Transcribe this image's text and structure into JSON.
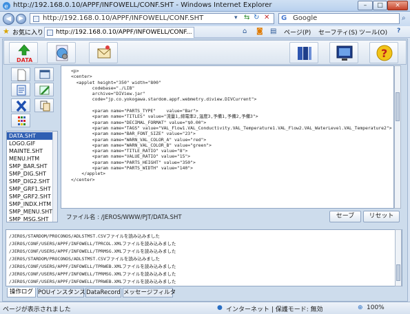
{
  "window": {
    "title": "http://192.168.0.10/APPF/INFOWELL/CONF.SHT - Windows Internet Explorer",
    "controls": {
      "minimize": "–",
      "maximize": "□",
      "close": "×"
    }
  },
  "browser": {
    "address": "http://192.168.0.10/APPF/INFOWELL/CONF.SHT",
    "search_placeholder": "Google",
    "favorites_label": "お気に入り",
    "tab_title": "http://192.168.0.10/APPF/INFOWELL/CONF...",
    "commands": {
      "page": "ページ(P)",
      "safety": "セーフティ(S)",
      "tools": "ツール(O)",
      "help": "?"
    }
  },
  "toolbar": {
    "data_label": "DATA"
  },
  "file_list": {
    "items": [
      "DATA.SHT",
      "LOGO.GIF",
      "MAINTE.SHT",
      "MENU.HTM",
      "SMP_BAR.SHT",
      "SMP_DIG.SHT",
      "SMP_DIG2.SHT",
      "SMP_GRF1.SHT",
      "SMP_GRF2.SHT",
      "SMP_INDX.HTM",
      "SMP_MENU.SHT",
      "SMP_MSG.SHT"
    ],
    "selected_index": 0
  },
  "editor": {
    "code": "<p>\n<center>\n  <applet height=\"350\" width=\"800\"\n        codebase=\"./LIB\"\n        archive=\"DIView.jar\"\n        code=\"jp.co.yokogawa.stardom.appf.webmetry.diview.DIVCurrent\">\n\n        <param name=\"PARTS_TYPE\"    value=\"Bar\">\n        <param name=\"TITLES\" value=\"流量1,締電率2,温度3,予備1,予備2,予備3\">\n        <param name=\"DECIMAL_FORMAT\" value=\"$0.00\">\n        <param name=\"TAGS\" value=\"VAL_Flow1.VAL_Conductivity.VAL_Temperature1.VAL_Flow2.VAL_WaterLevel.VAL_Temperature2\">\n        <param name=\"BAR_FONT_SIZE\" value=\"23\">\n        <param name=\"WARN_VAL_COLOR_A\" value=\"red\">\n        <param name=\"WARN_VAL_COLOR_B\" value=\"green\">\n        <param name=\"TITLE_RATIO\" value=\"8\">\n        <param name=\"VALUE_RATIO\" value=\"15\">\n        <param name=\"PARTS_HEIGHT\" value=\"350\">\n        <param name=\"PARTS_WIDTH\" value=\"140\">\n    </applet>\n</center>",
    "file_name_label": "ファイル名 : /JEROS/WWW/PJT/DATA.SHT",
    "save_label": "セーブ",
    "reset_label": "リセット"
  },
  "log": {
    "lines": [
      "/JEROS/STARDOM/PROCONOS/ADLSTMST.CSVファイルを読み込みました",
      "/JEROS/CONF/USERS/APPF/INFOWELL/TPRCOL.XMLファイルを読み込みました",
      "/JEROS/CONF/USERS/APPF/INFOWELL/TPRMSG.XMLファイルを読み込みました",
      "/JEROS/STARDOM/PROCONOS/ADLSTMST.CSVファイルを読み込みました",
      "/JEROS/CONF/USERS/APPF/INFOWELL/TPRWEB.XMLファイルを読み込みました",
      "/JEROS/CONF/USERS/APPF/INFOWELL/TPRMSG.XMLファイルを読み込みました",
      "/JEROS/CONF/USERS/APPF/INFOWELL/TPRWEB.XMLファイルを読み込みました"
    ]
  },
  "bottom_tabs": [
    "操作ログ",
    "POUインスタンス",
    "DataRecord",
    "メッセージフィルタ"
  ],
  "status": {
    "message": "ページが表示されました",
    "zone": "インターネット | 保護モード: 無効",
    "zoom": "100%"
  }
}
